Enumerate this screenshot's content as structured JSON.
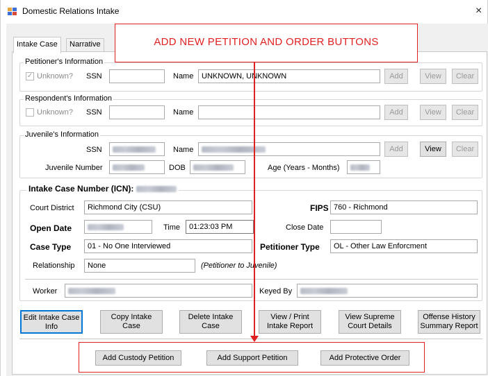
{
  "window": {
    "title": "Domestic Relations Intake",
    "close": "×"
  },
  "tabs": [
    {
      "label": "Intake Case"
    },
    {
      "label": "Narrative"
    }
  ],
  "callout": {
    "text": "ADD NEW PETITION AND ORDER BUTTONS",
    "color": "#e02020"
  },
  "petitioner": {
    "title": "Petitioner's Information",
    "unknown_label": "Unknown?",
    "unknown_checked": true,
    "ssn_label": "SSN",
    "ssn_value": "",
    "name_label": "Name",
    "name_value": "UNKNOWN, UNKNOWN",
    "add": "Add",
    "view": "View",
    "clear": "Clear"
  },
  "respondent": {
    "title": "Respondent's Information",
    "unknown_label": "Unknown?",
    "unknown_checked": false,
    "ssn_label": "SSN",
    "ssn_value": "",
    "name_label": "Name",
    "name_value": "",
    "add": "Add",
    "view": "View",
    "clear": "Clear"
  },
  "juvenile": {
    "title": "Juvenile's Information",
    "ssn_label": "SSN",
    "name_label": "Name",
    "add": "Add",
    "view": "View",
    "clear": "Clear",
    "number_label": "Juvenile Number",
    "dob_label": "DOB",
    "age_label": "Age (Years - Months)"
  },
  "intake": {
    "title": "Intake Case Number (ICN):",
    "court_district_label": "Court District",
    "court_district_value": "Richmond City (CSU)",
    "fips_label": "FIPS",
    "fips_value": "760 - Richmond",
    "open_date_label": "Open Date",
    "time_label": "Time",
    "time_value": "01:23:03 PM",
    "close_date_label": "Close Date",
    "close_date_value": "",
    "case_type_label": "Case Type",
    "case_type_value": "01 - No One Interviewed",
    "petitioner_type_label": "Petitioner Type",
    "petitioner_type_value": "OL - Other Law Enforcment",
    "relationship_label": "Relationship",
    "relationship_value": "None",
    "relationship_note": "(Petitioner to Juvenile)",
    "worker_label": "Worker",
    "keyed_by_label": "Keyed By"
  },
  "actions": {
    "edit_1": "Edit Intake Case",
    "edit_2": "Info",
    "copy_1": "Copy Intake",
    "copy_2": "Case",
    "delete_1": "Delete Intake",
    "delete_2": "Case",
    "print_1": "View / Print",
    "print_2": "Intake Report",
    "supreme_1": "View Supreme",
    "supreme_2": "Court Details",
    "offense_1": "Offense History",
    "offense_2": "Summary Report"
  },
  "petitions": {
    "custody": "Add Custody Petition",
    "support": "Add Support Petition",
    "protective": "Add Protective Order"
  }
}
